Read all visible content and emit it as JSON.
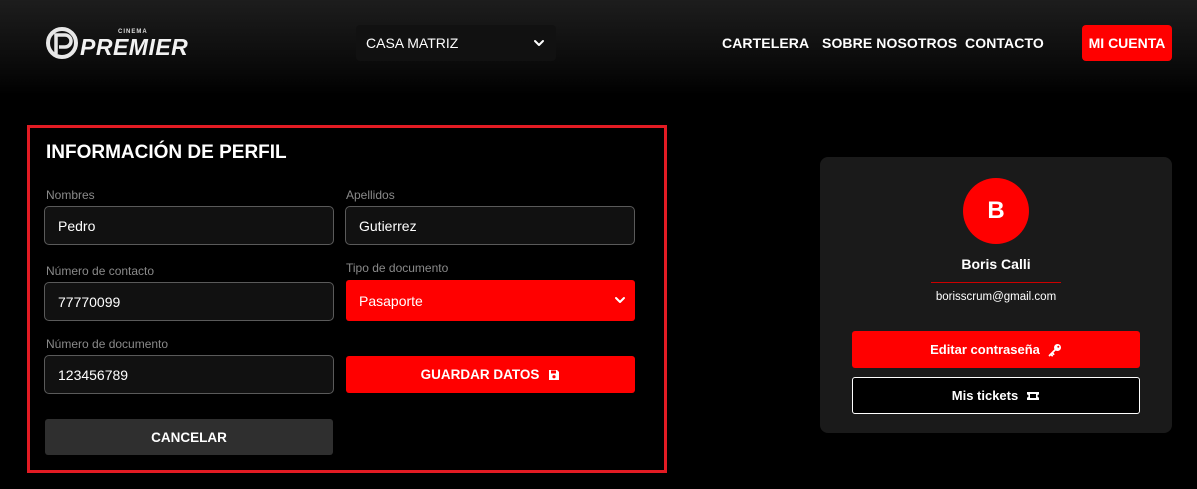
{
  "brand": {
    "small_text": "CINEMA",
    "name": "PREMIER",
    "accent_color": "#ff0000",
    "frame_color": "#e31b23"
  },
  "header": {
    "branch_select": {
      "value": "CASA MATRIZ",
      "icon": "chevron-down-icon"
    },
    "nav": [
      {
        "label": "CARTELERA"
      },
      {
        "label": "SOBRE NOSOTROS"
      },
      {
        "label": "CONTACTO"
      }
    ],
    "account_button": "MI CUENTA"
  },
  "profile_form": {
    "title": "INFORMACIÓN DE PERFIL",
    "fields": {
      "first_name": {
        "label": "Nombres",
        "value": "Pedro"
      },
      "last_name": {
        "label": "Apellidos",
        "value": "Gutierrez"
      },
      "phone": {
        "label": "Número de contacto",
        "value": "77770099"
      },
      "doc_type": {
        "label": "Tipo de documento",
        "value": "Pasaporte",
        "icon": "chevron-down-icon"
      },
      "doc_number": {
        "label": "Número de documento",
        "value": "123456789"
      }
    },
    "save_button": {
      "label": "GUARDAR DATOS",
      "icon": "save-icon"
    },
    "cancel_button": "CANCELAR"
  },
  "user_card": {
    "avatar_initial": "B",
    "name": "Boris Calli",
    "email": "borisscrum@gmail.com",
    "edit_password_button": {
      "label": "Editar contraseña",
      "icon": "key-icon"
    },
    "tickets_button": {
      "label": "Mis tickets",
      "icon": "ticket-icon"
    }
  }
}
